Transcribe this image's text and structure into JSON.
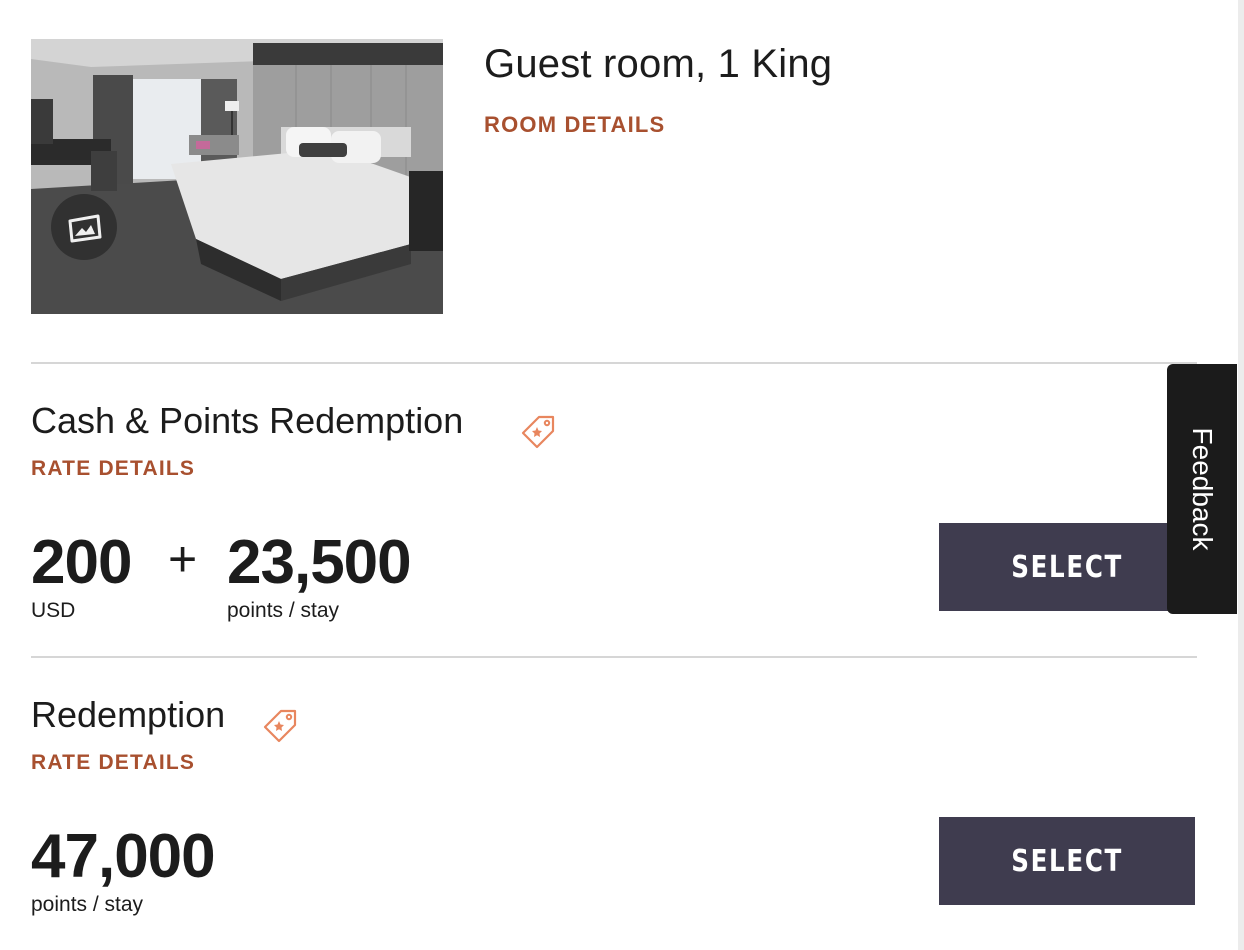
{
  "room": {
    "title": "Guest room, 1 King",
    "details_link": "ROOM DETAILS",
    "photo_alt": "Guest room with king bed"
  },
  "rates": [
    {
      "title": "Cash & Points Redemption",
      "details_link": "RATE DETAILS",
      "cash_amount": "200",
      "cash_unit": "USD",
      "plus": "+",
      "points_amount": "23,500",
      "points_unit": "points / stay",
      "select_label": "SELECT"
    },
    {
      "title": "Redemption",
      "details_link": "RATE DETAILS",
      "points_amount": "47,000",
      "points_unit": "points / stay",
      "select_label": "SELECT"
    }
  ],
  "feedback": {
    "label": "Feedback"
  },
  "icons": {
    "gallery": "photo-gallery-icon",
    "tag": "points-tag-icon"
  },
  "colors": {
    "accent": "#a8502f",
    "tag_icon": "#e8865e",
    "button_bg": "#3f3c4f",
    "feedback_bg": "#1b1b1b",
    "divider": "#d6d6d6"
  }
}
